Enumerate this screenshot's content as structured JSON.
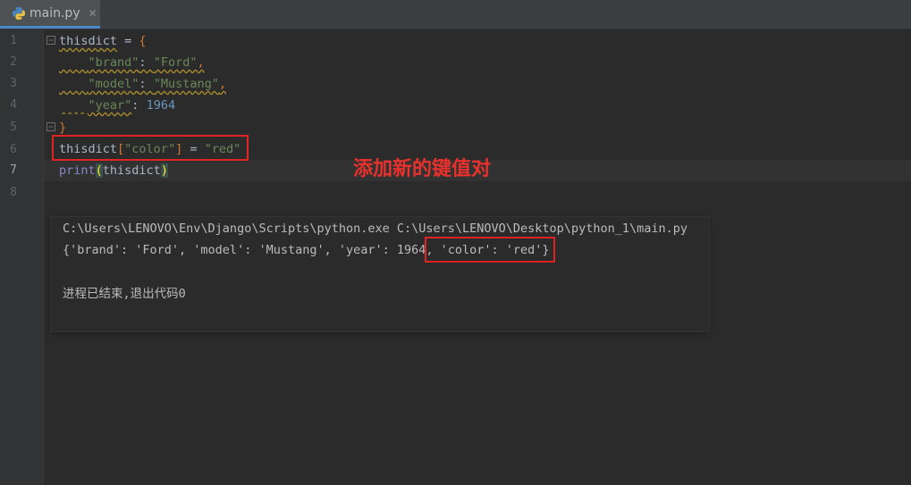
{
  "tab": {
    "filename": "main.py",
    "close_glyph": "✕",
    "icon": "python-file-icon"
  },
  "gutter": {
    "line_numbers": [
      "1",
      "2",
      "3",
      "4",
      "5",
      "6",
      "7",
      "8"
    ],
    "current_line": "7"
  },
  "code": {
    "line1": {
      "var": "thisdict",
      "op": " = ",
      "brace": "{"
    },
    "line2": {
      "key": "\"brand\"",
      "colon": ": ",
      "val": "\"Ford\"",
      "comma": ","
    },
    "line3": {
      "key": "\"model\"",
      "colon": ": ",
      "val": "\"Mustang\"",
      "comma": ","
    },
    "line4": {
      "key": "\"year\"",
      "colon": ": ",
      "val": "1964"
    },
    "line5": {
      "brace": "}"
    },
    "line6": {
      "var": "thisdict",
      "lbr": "[",
      "key": "\"color\"",
      "rbr": "]",
      "op": " = ",
      "val": "\"red\""
    },
    "line7": {
      "fn": "print",
      "lp": "(",
      "arg": "thisdict",
      "rp": ")"
    }
  },
  "annotation": {
    "text": "添加新的键值对",
    "color": "#e02424"
  },
  "console": {
    "command": "C:\\Users\\LENOVO\\Env\\Django\\Scripts\\python.exe C:\\Users\\LENOVO\\Desktop\\python_1\\main.py",
    "output_prefix": "{'brand': 'Ford', 'model': 'Mustang', 'year': 1964,",
    "output_suffix": " 'color': 'red'}",
    "exit_message": "进程已结束,退出代码0"
  },
  "colors": {
    "background": "#2b2b2b",
    "string": "#6a8759",
    "number": "#6897bb",
    "builtin": "#8888c6",
    "keyword_orange": "#cc7832",
    "default_text": "#a9b7c6",
    "accent_tab": "#4a88c7"
  }
}
